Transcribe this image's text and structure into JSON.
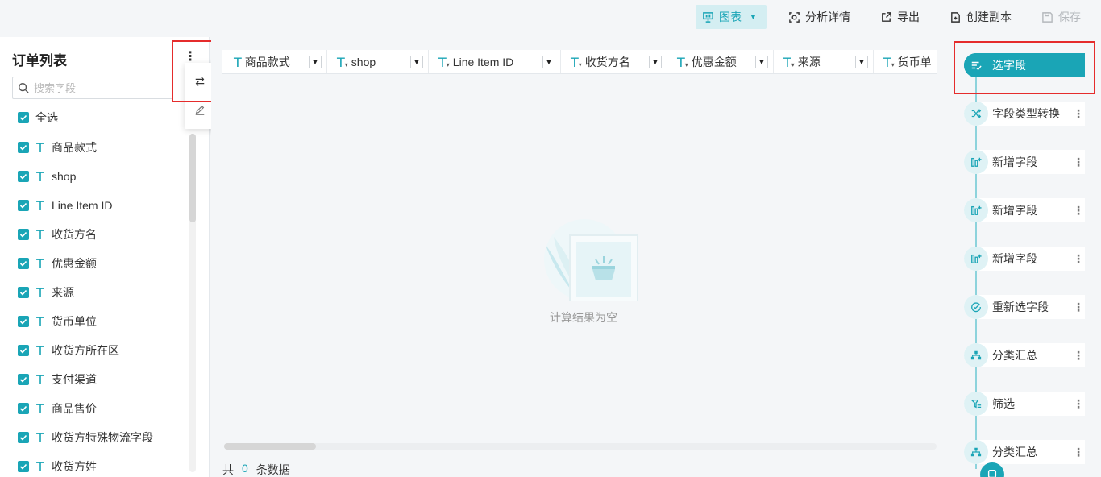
{
  "toolbar": {
    "chart_label": "图表",
    "analysis_label": "分析详情",
    "export_label": "导出",
    "copy_label": "创建副本",
    "save_label": "保存"
  },
  "left_panel": {
    "title": "订单列表",
    "search_placeholder": "搜索字段",
    "select_all": "全选",
    "fields": [
      "商品款式",
      "shop",
      "Line Item ID",
      "收货方名",
      "优惠金额",
      "来源",
      "货币单位",
      "收货方所在区",
      "支付渠道",
      "商品售价",
      "收货方特殊物流字段",
      "收货方姓"
    ]
  },
  "popup_menu": {
    "items": [
      "切换",
      "编辑"
    ]
  },
  "grid": {
    "columns": [
      "商品款式",
      "shop",
      "Line Item ID",
      "收货方名",
      "优惠金额",
      "来源",
      "货币单"
    ],
    "empty_text": "计算结果为空",
    "footer_prefix": "共",
    "footer_count": "0",
    "footer_suffix": "条数据"
  },
  "steps": {
    "items": [
      "选字段",
      "字段类型转换",
      "新增字段",
      "新增字段",
      "新增字段",
      "重新选字段",
      "分类汇总",
      "筛选",
      "分类汇总"
    ]
  },
  "colors": {
    "accent": "#1aa5b6",
    "highlight_box": "#e52c2c"
  }
}
